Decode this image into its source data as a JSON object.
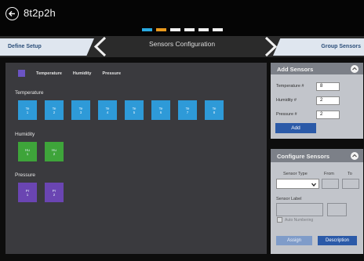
{
  "app": {
    "title": "8t2p2h"
  },
  "progress": {
    "total_steps": 6,
    "completed_steps": 2
  },
  "nav": {
    "left_label": "Define Setup",
    "title": "Sensors Configuration",
    "right_label": "Group Sensors"
  },
  "legend": [
    "Temperature",
    "Humidity",
    "Pressure"
  ],
  "sections": {
    "temperature": {
      "label": "Temperature",
      "tiles": [
        {
          "l1": "Te",
          "l2": "1"
        },
        {
          "l1": "Te",
          "l2": "2"
        },
        {
          "l1": "Te",
          "l2": "3"
        },
        {
          "l1": "Te",
          "l2": "4"
        },
        {
          "l1": "Te",
          "l2": "5"
        },
        {
          "l1": "Te",
          "l2": "6"
        },
        {
          "l1": "Te",
          "l2": "7"
        },
        {
          "l1": "Te",
          "l2": "8"
        }
      ]
    },
    "humidity": {
      "label": "Humidity",
      "tiles": [
        {
          "l1": "Hu",
          "l2": "1"
        },
        {
          "l1": "Hu",
          "l2": "2"
        }
      ]
    },
    "pressure": {
      "label": "Pressure",
      "tiles": [
        {
          "l1": "Pr",
          "l2": "1"
        },
        {
          "l1": "Pr",
          "l2": "2"
        }
      ]
    }
  },
  "add_sensors": {
    "title": "Add Sensors",
    "temperature_label": "Temperature #",
    "temperature_value": "8",
    "humidity_label": "Humidity #",
    "humidity_value": "2",
    "pressure_label": "Pressure #",
    "pressure_value": "2",
    "add_button": "Add"
  },
  "configure_sensors": {
    "title": "Configure Sensors",
    "sensor_type_label": "Sensor Type",
    "from_label": "From",
    "to_label": "To",
    "sensor_label_label": "Sensor Label",
    "auto_numbering_label": "Auto Numbering",
    "assign_button": "Assign",
    "description_button": "Description"
  },
  "colors": {
    "temperature": "#2e9ad8",
    "humidity": "#3ea43a",
    "pressure": "#6a45b2",
    "accent": "#2b5aa8",
    "step_active_1": "#29a9e0",
    "step_active_2": "#ea9a1d"
  }
}
